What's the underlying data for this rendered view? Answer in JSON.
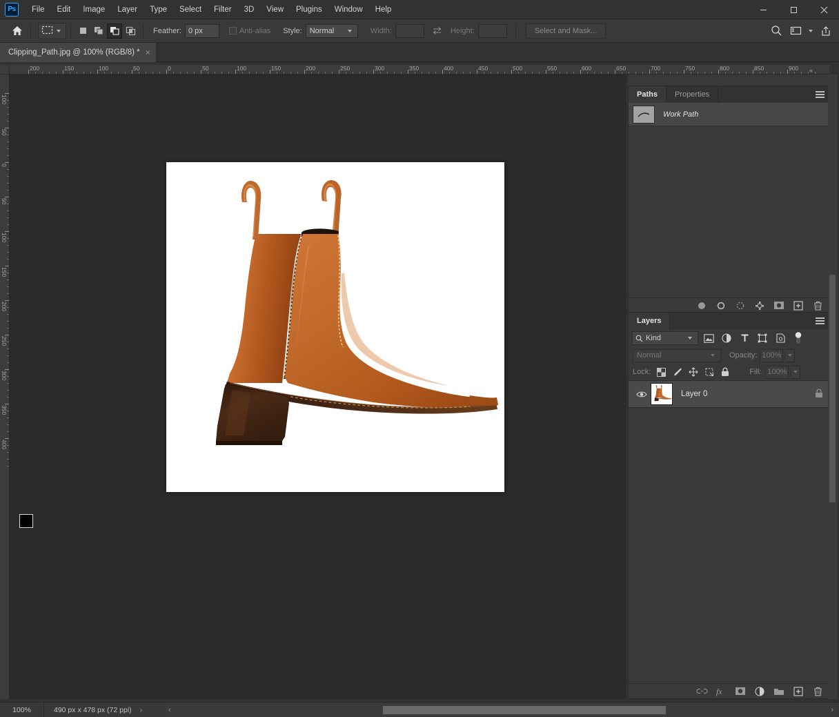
{
  "app": {
    "logo": "Ps",
    "menus": [
      "File",
      "Edit",
      "Image",
      "Layer",
      "Type",
      "Select",
      "Filter",
      "3D",
      "View",
      "Plugins",
      "Window",
      "Help"
    ],
    "window_controls": [
      "minimize-icon",
      "maximize-icon",
      "close-icon"
    ]
  },
  "options_bar": {
    "home_icon": "home-icon",
    "tool_preset_icon": "rectangular-marquee-icon",
    "selection_modes": [
      "new-selection",
      "add-to-selection",
      "subtract-from-selection",
      "intersect-with-selection"
    ],
    "active_selection_mode_index": 2,
    "feather_label": "Feather:",
    "feather_value": "0 px",
    "antialias_label": "Anti-alias",
    "antialias_checked": false,
    "style_label": "Style:",
    "style_value": "Normal",
    "width_label": "Width:",
    "width_value": "",
    "swap_icon": "swap-dimensions-icon",
    "height_label": "Height:",
    "height_value": "",
    "select_and_mask_label": "Select and Mask...",
    "right_icons": [
      "search-icon",
      "workspace-icon",
      "chevron-down-icon",
      "share-icon"
    ]
  },
  "document": {
    "tab_title": "Clipping_Path.jpg @ 100% (RGB/8) *",
    "close_glyph": "×",
    "image": {
      "alt": "brown-leather-chelsea-boot",
      "background": "#ffffff",
      "leather_color": "#b5591f",
      "leather_highlight": "#d97b3a",
      "leather_shadow": "#8c3f12",
      "gusset_color": "#5a3324",
      "sole_color": "#4b2a16",
      "stitch_color": "#e8c58f"
    }
  },
  "rulers": {
    "horizontal_labels": [
      "200",
      "150",
      "100",
      "50",
      "0",
      "50",
      "100",
      "150",
      "200",
      "250",
      "300",
      "350",
      "400",
      "450",
      "500",
      "550",
      "600",
      "650",
      "700",
      "750",
      "800",
      "850",
      "900"
    ],
    "vertical_labels": [
      "100",
      "50",
      "0",
      "50",
      "100",
      "150",
      "200",
      "250",
      "300",
      "350",
      "400"
    ],
    "unit": "px"
  },
  "toolbar": {
    "collapse_icon": "double-chevron-right-icon",
    "close_icon": "close-icon",
    "tools": [
      {
        "name": "move-tool",
        "icon": "move-icon",
        "active": false,
        "has_flyout": true
      },
      {
        "name": "rectangular-marquee-tool",
        "icon": "marquee-icon",
        "active": true,
        "has_flyout": true
      },
      {
        "name": "lasso-tool",
        "icon": "lasso-icon",
        "active": false,
        "has_flyout": true
      },
      {
        "name": "object-selection-tool",
        "icon": "magic-wand-icon",
        "active": false,
        "has_flyout": true
      },
      {
        "name": "crop-tool",
        "icon": "crop-icon",
        "active": false,
        "has_flyout": true
      },
      {
        "name": "frame-tool",
        "icon": "frame-icon",
        "active": false,
        "has_flyout": false
      },
      {
        "name": "eyedropper-tool",
        "icon": "eyedropper-icon",
        "active": false,
        "has_flyout": true
      },
      {
        "name": "spot-healing-brush-tool",
        "icon": "healing-brush-icon",
        "active": false,
        "has_flyout": true
      },
      {
        "name": "brush-tool",
        "icon": "brush-icon",
        "active": false,
        "has_flyout": true
      },
      {
        "name": "clone-stamp-tool",
        "icon": "clone-stamp-icon",
        "active": false,
        "has_flyout": true
      },
      {
        "name": "history-brush-tool",
        "icon": "history-brush-icon",
        "active": false,
        "has_flyout": true
      },
      {
        "name": "eraser-tool",
        "icon": "eraser-icon",
        "active": false,
        "has_flyout": true
      },
      {
        "name": "gradient-tool",
        "icon": "gradient-icon",
        "active": false,
        "has_flyout": true
      },
      {
        "name": "blur-tool",
        "icon": "water-drop-icon",
        "active": false,
        "has_flyout": true
      },
      {
        "name": "dodge-tool",
        "icon": "dodge-icon",
        "active": false,
        "has_flyout": true
      },
      {
        "name": "pen-tool",
        "icon": "pen-icon",
        "active": false,
        "has_flyout": true
      },
      {
        "name": "type-tool",
        "icon": "type-t-icon",
        "active": false,
        "has_flyout": true
      },
      {
        "name": "path-selection-tool",
        "icon": "path-arrow-icon",
        "active": false,
        "has_flyout": true
      },
      {
        "name": "ellipse-tool",
        "icon": "ellipse-icon",
        "active": false,
        "has_flyout": true
      },
      {
        "name": "hand-tool",
        "icon": "hand-icon",
        "active": false,
        "has_flyout": true
      },
      {
        "name": "zoom-tool",
        "icon": "magnifier-icon",
        "active": false,
        "has_flyout": false
      },
      {
        "name": "edit-toolbar-tool",
        "icon": "ellipsis-icon",
        "active": false,
        "has_flyout": true
      }
    ],
    "default_colors_icon": "default-colors-icon",
    "swap_colors_icon": "swap-colors-icon",
    "foreground_color": "#000000",
    "background_color": "#ffffff",
    "quick_mask_icon": "quick-mask-icon",
    "screen_mode_icon": "screen-mode-icon"
  },
  "paths_panel": {
    "tabs": [
      {
        "label": "Paths",
        "active": true
      },
      {
        "label": "Properties",
        "active": false
      }
    ],
    "menu_icon": "panel-menu-icon",
    "items": [
      {
        "name": "Work Path",
        "thumbnail": "path-thumbnail",
        "selected": true
      }
    ],
    "footer_buttons": [
      {
        "name": "fill-path-button",
        "icon": "fill-path-icon"
      },
      {
        "name": "stroke-path-button",
        "icon": "stroke-path-icon"
      },
      {
        "name": "load-path-as-selection-button",
        "icon": "selection-from-path-icon"
      },
      {
        "name": "make-work-path-button",
        "icon": "path-from-selection-icon"
      },
      {
        "name": "add-layer-mask-button",
        "icon": "mask-icon"
      },
      {
        "name": "new-path-button",
        "icon": "plus-icon"
      },
      {
        "name": "delete-path-button",
        "icon": "trash-icon"
      }
    ]
  },
  "layers_panel": {
    "tabs": [
      {
        "label": "Layers",
        "active": true
      }
    ],
    "menu_icon": "panel-menu-icon",
    "filter": {
      "search_icon": "search-icon",
      "kind_label": "Kind",
      "type_filters": [
        {
          "name": "filter-pixel-layers",
          "icon": "image-icon"
        },
        {
          "name": "filter-adjustment-layers",
          "icon": "adjustment-icon"
        },
        {
          "name": "filter-type-layers",
          "icon": "type-t-icon"
        },
        {
          "name": "filter-shape-layers",
          "icon": "shape-icon"
        },
        {
          "name": "filter-smart-objects",
          "icon": "smart-object-icon"
        }
      ],
      "toggle_name": "filter-toggle-switch"
    },
    "blend_mode": "Normal",
    "opacity_label": "Opacity:",
    "opacity_value": "100%",
    "lock_label": "Lock:",
    "lock_buttons": [
      {
        "name": "lock-transparent-pixels",
        "icon": "checkerboard-icon"
      },
      {
        "name": "lock-image-pixels",
        "icon": "brush-icon"
      },
      {
        "name": "lock-position",
        "icon": "move-icon"
      },
      {
        "name": "lock-artboard-nesting",
        "icon": "artboard-icon"
      },
      {
        "name": "lock-all",
        "icon": "lock-icon"
      }
    ],
    "fill_label": "Fill:",
    "fill_value": "100%",
    "layers": [
      {
        "name": "Layer 0",
        "visible": true,
        "locked": true,
        "thumbnail": "boot-thumbnail",
        "selected": true
      }
    ],
    "footer_buttons": [
      {
        "name": "link-layers-button",
        "icon": "link-icon"
      },
      {
        "name": "layer-style-button",
        "icon": "fx-icon"
      },
      {
        "name": "add-layer-mask-button",
        "icon": "mask-icon"
      },
      {
        "name": "new-adjustment-layer-button",
        "icon": "adjustment-icon"
      },
      {
        "name": "new-group-button",
        "icon": "folder-icon"
      },
      {
        "name": "new-layer-button",
        "icon": "plus-icon"
      },
      {
        "name": "delete-layer-button",
        "icon": "trash-icon"
      }
    ]
  },
  "status_bar": {
    "zoom": "100%",
    "doc_info": "490 px x 478 px (72 ppi)",
    "expand_glyph": "›",
    "scroll_left_glyph": "‹",
    "scroll_right_glyph": "›"
  }
}
